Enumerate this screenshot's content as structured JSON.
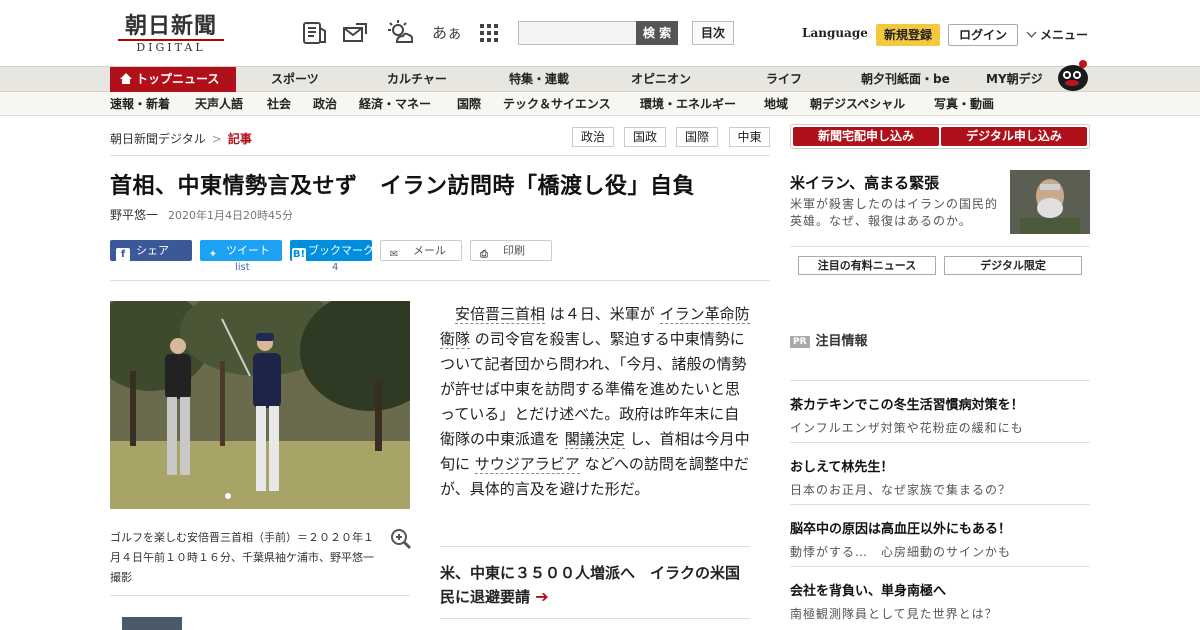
{
  "header": {
    "logo_jp": "朝日新聞",
    "logo_en": "DIGITAL",
    "icons": [
      "newspaper-icon",
      "mail-icon",
      "weather-icon",
      "font-size-icon",
      "apps-grid-icon"
    ],
    "font_icon_text": "あぁ",
    "search_placeholder": "",
    "search_button": "検 索",
    "toc_button": "目次",
    "language": "Language",
    "signup": "新規登録",
    "login": "ログイン",
    "menu": "メニュー"
  },
  "nav_primary": [
    "トップニュース",
    "スポーツ",
    "カルチャー",
    "特集・連載",
    "オピニオン",
    "ライフ",
    "朝夕刊紙面・be",
    "MY朝デジ"
  ],
  "nav_secondary": [
    "速報・新着",
    "天声人語",
    "社会",
    "政治",
    "経済・マネー",
    "国際",
    "テック＆サイエンス",
    "環境・エネルギー",
    "地域",
    "朝デジスペシャル",
    "写真・動画"
  ],
  "breadcrumb": {
    "home": "朝日新聞デジタル",
    "sep": ">",
    "current": "記事"
  },
  "tags": [
    "政治",
    "国政",
    "国際",
    "中東"
  ],
  "article": {
    "headline": "首相、中東情勢言及せず　イラン訪問時「橋渡し役」自負",
    "author": "野平悠一",
    "date": "2020年1月4日20時45分",
    "share": {
      "facebook": "シェア",
      "twitter": "ツイート",
      "twitter_count": "list",
      "hatena": "ブックマーク",
      "hatena_count": "4",
      "mail": "メール",
      "print": "印刷"
    },
    "caption": "ゴルフを楽しむ安倍晋三首相（手前）＝２０２０年１月４日午前１０時１６分、千葉県袖ケ浦市、野平悠一撮影",
    "body": {
      "p1": "安倍晋三首相",
      "p2": "は４日、米軍が",
      "p3": "イラン革命防衛隊",
      "p4": "の司令官を殺害し、緊迫する中東情勢について記者団から問われ、「今月、諸般の情勢が許せば中東を訪問する準備を進めたいと思っている」とだけ述べた。政府は昨年末に自衛隊の中東派遣を",
      "p5": "閣議決定",
      "p6": "し、首相は今月中旬に",
      "p7": "サウジアラビア",
      "p8": "などへの訪問を調整中だが、具体的言及を避けた形だ。"
    },
    "related": "米、中東に３５００人増派へ　イラクの米国民に退避要請"
  },
  "sidebar": {
    "btn1": "新聞宅配申し込み",
    "btn2": "デジタル申し込み",
    "feature_title": "米イラン、高まる緊張",
    "feature_sub": "米軍が殺害したのはイランの国民的英雄。なぜ、報復はあるのか。",
    "tab1": "注目の有料ニュース",
    "tab2": "デジタル限定",
    "pr_badge": "PR",
    "pr_label": "注目情報",
    "ads": [
      {
        "title": "茶カテキンでこの冬生活習慣病対策を！",
        "sub": "インフルエンザ対策や花粉症の緩和にも"
      },
      {
        "title": "おしえて林先生！",
        "sub": "日本のお正月、なぜ家族で集まるの？"
      },
      {
        "title": "脳卒中の原因は高血圧以外にもある！",
        "sub": "動悸がする…　心房細動のサインかも"
      },
      {
        "title": "会社を背負い、単身南極へ",
        "sub": "南極観測隊員として見た世界とは？"
      }
    ]
  },
  "colors": {
    "brand_red": "#b0101a",
    "facebook": "#3b5998",
    "twitter": "#1da1f2",
    "hatena": "#008fde",
    "signup": "#f6c83d"
  }
}
